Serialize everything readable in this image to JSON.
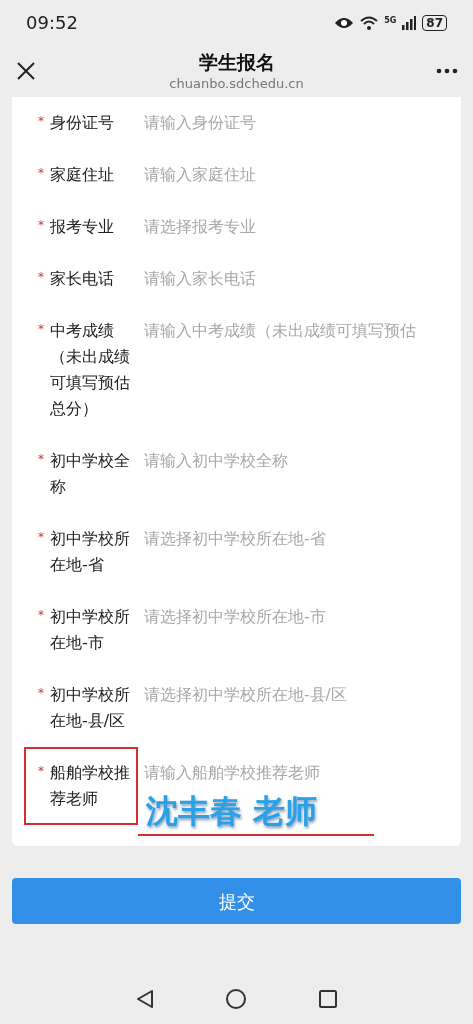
{
  "status_bar": {
    "time": "09:52",
    "network": "5G",
    "battery": "87"
  },
  "header": {
    "title": "学生报名",
    "url": "chuanbo.sdchedu.cn"
  },
  "fields": [
    {
      "required_mark": "*",
      "label": "身份证号",
      "placeholder": "请输入身份证号",
      "highlighted": false
    },
    {
      "required_mark": "*",
      "label": "家庭住址",
      "placeholder": "请输入家庭住址",
      "highlighted": false
    },
    {
      "required_mark": "*",
      "label": "报考专业",
      "placeholder": "请选择报考专业",
      "highlighted": false
    },
    {
      "required_mark": "*",
      "label": "家长电话",
      "placeholder": "请输入家长电话",
      "highlighted": false
    },
    {
      "required_mark": "*",
      "label": "中考成绩（未出成绩可填写预估总分）",
      "placeholder": "请输入中考成绩（未出成绩可填写预估",
      "highlighted": false
    },
    {
      "required_mark": "*",
      "label": "初中学校全称",
      "placeholder": "请输入初中学校全称",
      "highlighted": false
    },
    {
      "required_mark": "*",
      "label": "初中学校所在地-省",
      "placeholder": "请选择初中学校所在地-省",
      "highlighted": false
    },
    {
      "required_mark": "*",
      "label": "初中学校所在地-市",
      "placeholder": "请选择初中学校所在地-市",
      "highlighted": false
    },
    {
      "required_mark": "*",
      "label": "初中学校所在地-县/区",
      "placeholder": "请选择初中学校所在地-县/区",
      "highlighted": false
    },
    {
      "required_mark": "*",
      "label": "船舶学校推荐老师",
      "placeholder": "请输入船舶学校推荐老师",
      "highlighted": true,
      "annotation": "沈丰春 老师"
    }
  ],
  "submit_button": "提交"
}
